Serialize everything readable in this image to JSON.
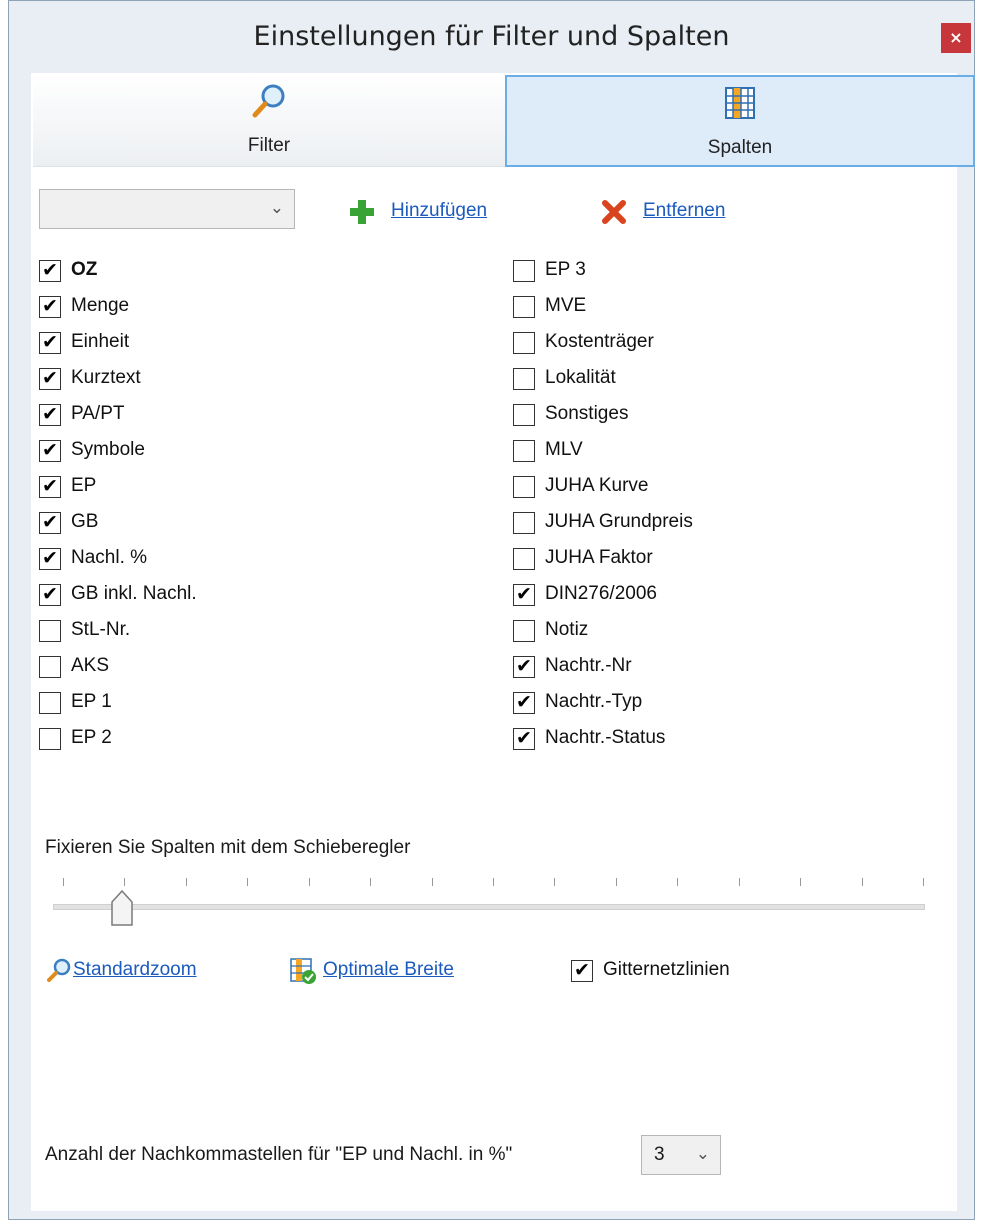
{
  "window": {
    "title": "Einstellungen für Filter und Spalten",
    "close_label": "×"
  },
  "tabs": [
    {
      "label": "Filter",
      "icon": "magnifier-icon",
      "active": false
    },
    {
      "label": "Spalten",
      "icon": "columns-icon",
      "active": true
    }
  ],
  "toolbar": {
    "dropdown_value": "",
    "add_label": "Hinzufügen",
    "remove_label": "Entfernen"
  },
  "columns_left": [
    {
      "label": "OZ",
      "checked": true,
      "bold": true
    },
    {
      "label": "Menge",
      "checked": true
    },
    {
      "label": "Einheit",
      "checked": true
    },
    {
      "label": "Kurztext",
      "checked": true
    },
    {
      "label": "PA/PT",
      "checked": true
    },
    {
      "label": "Symbole",
      "checked": true
    },
    {
      "label": "EP",
      "checked": true
    },
    {
      "label": "GB",
      "checked": true
    },
    {
      "label": "Nachl. %",
      "checked": true
    },
    {
      "label": "GB inkl. Nachl.",
      "checked": true
    },
    {
      "label": "StL-Nr.",
      "checked": false
    },
    {
      "label": "AKS",
      "checked": false
    },
    {
      "label": "EP 1",
      "checked": false
    },
    {
      "label": "EP 2",
      "checked": false
    }
  ],
  "columns_right": [
    {
      "label": "EP 3",
      "checked": false
    },
    {
      "label": "MVE",
      "checked": false
    },
    {
      "label": "Kostenträger",
      "checked": false
    },
    {
      "label": "Lokalität",
      "checked": false
    },
    {
      "label": "Sonstiges",
      "checked": false
    },
    {
      "label": "MLV",
      "checked": false
    },
    {
      "label": "JUHA Kurve",
      "checked": false
    },
    {
      "label": "JUHA Grundpreis",
      "checked": false
    },
    {
      "label": "JUHA Faktor",
      "checked": false
    },
    {
      "label": "DIN276/2006",
      "checked": true
    },
    {
      "label": "Notiz",
      "checked": false
    },
    {
      "label": "Nachtr.-Nr",
      "checked": true
    },
    {
      "label": "Nachtr.-Typ",
      "checked": true
    },
    {
      "label": "Nachtr.-Status",
      "checked": true
    }
  ],
  "slider": {
    "label": "Fixieren Sie Spalten mit dem Schieberegler",
    "tick_count": 15,
    "value_index": 1
  },
  "actions": {
    "standardzoom_label": "Standardzoom",
    "optimal_width_label": "Optimale Breite",
    "gridlines_label": "Gitternetzlinien",
    "gridlines_checked": true
  },
  "footer": {
    "decimals_label": "Anzahl der Nachkommastellen für \"EP und Nachl. in %\"",
    "decimals_value": "3"
  },
  "colors": {
    "accent": "#6aaee5",
    "link": "#1c5bbd",
    "close": "#c7363b",
    "add": "#3aa335",
    "remove": "#d9431e"
  }
}
